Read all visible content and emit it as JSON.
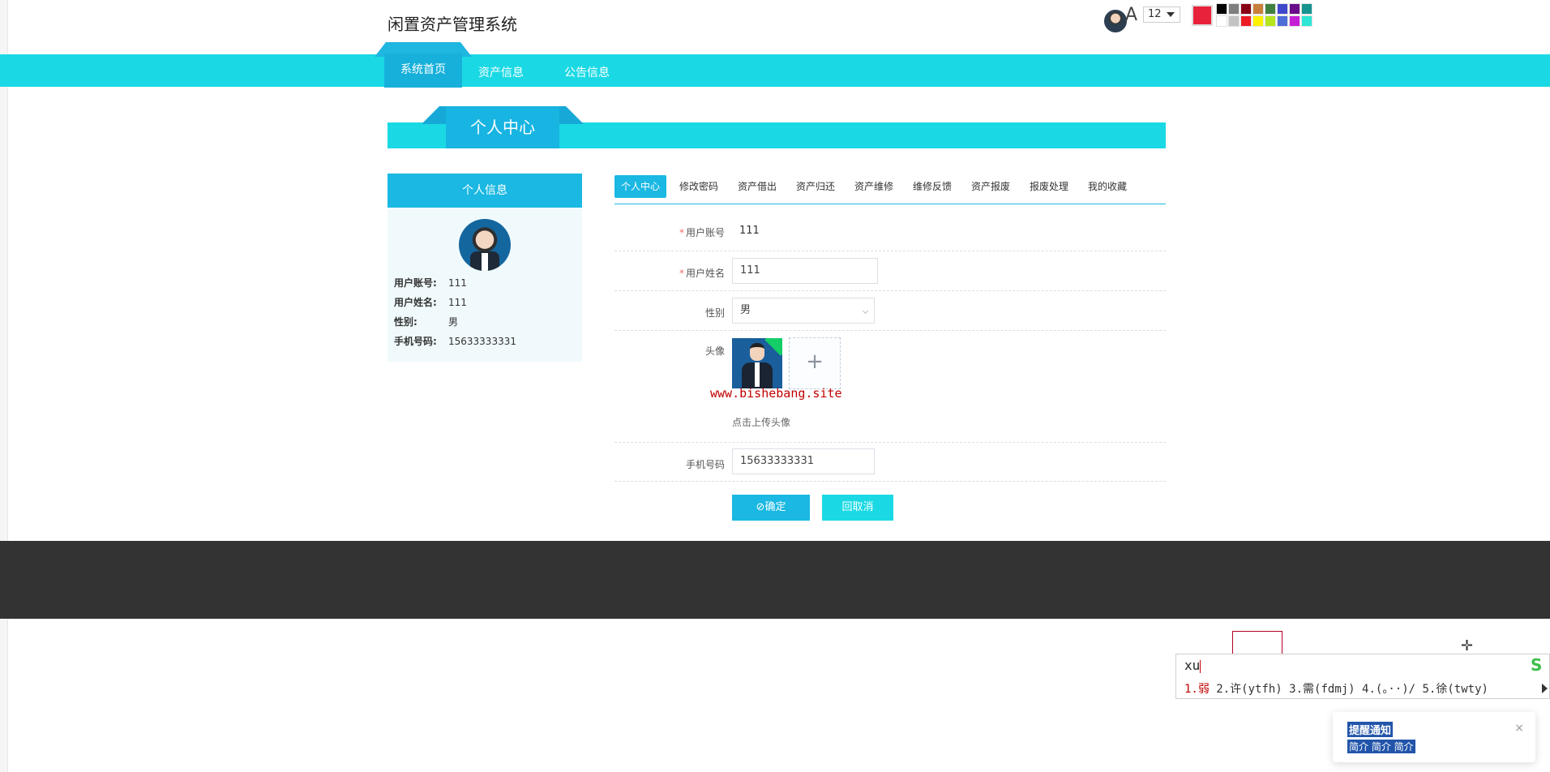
{
  "site": {
    "title": "闲置资产管理系统"
  },
  "toolbar": {
    "font_glyph": "A",
    "font_size": "12",
    "current_color": "#e8223a",
    "palette": [
      "#000000",
      "#7f7f7f",
      "#880015",
      "#c87f3b",
      "#40803f",
      "#3f48cc",
      "#6a0d8a",
      "#159490",
      "#ffffff",
      "#c3c3c3",
      "#ed1c24",
      "#fff200",
      "#b5e61d",
      "#4d6dd8",
      "#c41fd6",
      "#2de6d6"
    ]
  },
  "nav": {
    "items": [
      {
        "label": "系统首页",
        "active": true
      },
      {
        "label": "资产信息",
        "active": false
      },
      {
        "label": "公告信息",
        "active": false
      }
    ]
  },
  "section": {
    "title": "个人中心"
  },
  "profile": {
    "header": "个人信息",
    "fields": [
      {
        "key": "用户账号:",
        "value": "111"
      },
      {
        "key": "用户姓名:",
        "value": "111"
      },
      {
        "key": "性别:",
        "value": "男"
      },
      {
        "key": "手机号码:",
        "value": "15633333331"
      }
    ]
  },
  "tabs": [
    {
      "label": "个人中心",
      "active": true
    },
    {
      "label": "修改密码",
      "active": false
    },
    {
      "label": "资产借出",
      "active": false
    },
    {
      "label": "资产归还",
      "active": false
    },
    {
      "label": "资产维修",
      "active": false
    },
    {
      "label": "维修反馈",
      "active": false
    },
    {
      "label": "资产报废",
      "active": false
    },
    {
      "label": "报废处理",
      "active": false
    },
    {
      "label": "我的收藏",
      "active": false
    }
  ],
  "form": {
    "account": {
      "label": "用户账号",
      "required": "*",
      "value": "111"
    },
    "name": {
      "label": "用户姓名",
      "required": "*",
      "value": "111"
    },
    "gender": {
      "label": "性别",
      "value": "男"
    },
    "avatar": {
      "label": "头像",
      "upload_icon": "+",
      "tip": "点击上传头像"
    },
    "phone": {
      "label": "手机号码",
      "value": "15633333331"
    },
    "confirm_label": "⊘确定",
    "cancel_label": "回取消"
  },
  "watermark": "www.bishebang.site",
  "ime": {
    "input": "xu",
    "candidates": [
      "1.弱",
      "2.许(ytfh)",
      "3.需(fdmj)",
      "4.(。··)/",
      "5.徐(twty)"
    ]
  },
  "notification": {
    "title": "提醒通知",
    "message": "简介 简介 简介",
    "close": "×"
  },
  "colors": {
    "primary": "#1ab8e2",
    "nav": "#1ad9e4",
    "footer": "#333333",
    "danger": "#f56c6c"
  }
}
